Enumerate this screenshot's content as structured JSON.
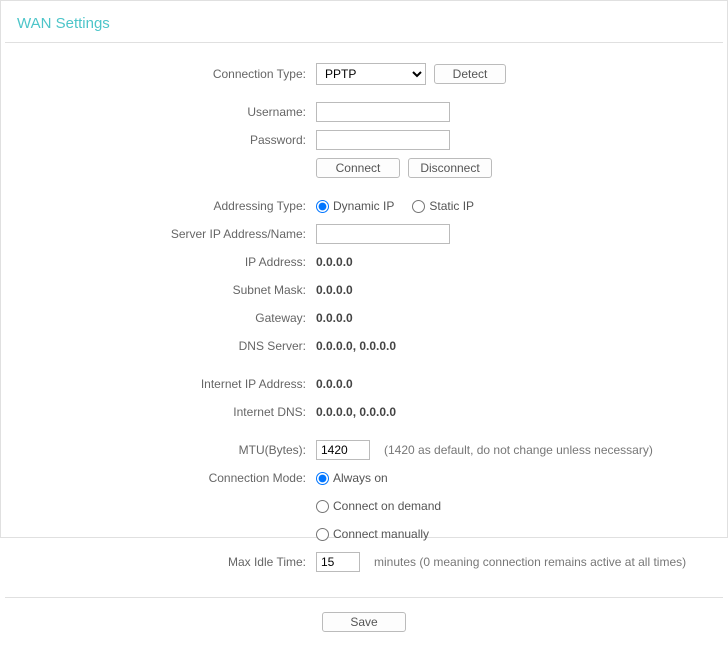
{
  "title": "WAN Settings",
  "labels": {
    "connection_type": "Connection Type:",
    "username": "Username:",
    "password": "Password:",
    "addressing_type": "Addressing Type:",
    "server_ip": "Server IP Address/Name:",
    "ip_address": "IP Address:",
    "subnet_mask": "Subnet Mask:",
    "gateway": "Gateway:",
    "dns_server": "DNS Server:",
    "internet_ip": "Internet IP Address:",
    "internet_dns": "Internet DNS:",
    "mtu": "MTU(Bytes):",
    "connection_mode": "Connection Mode:",
    "max_idle": "Max Idle Time:"
  },
  "connection_type": {
    "selected": "PPTP"
  },
  "buttons": {
    "detect": "Detect",
    "connect": "Connect",
    "disconnect": "Disconnect",
    "save": "Save"
  },
  "fields": {
    "username": "",
    "password": "",
    "server_ip_name": "",
    "mtu": "1420",
    "max_idle": "15"
  },
  "addressing": {
    "dynamic": "Dynamic IP",
    "static": "Static IP"
  },
  "status": {
    "ip_address": "0.0.0.0",
    "subnet_mask": "0.0.0.0",
    "gateway": "0.0.0.0",
    "dns_server": "0.0.0.0,   0.0.0.0",
    "internet_ip": "0.0.0.0",
    "internet_dns": "0.0.0.0,   0.0.0.0"
  },
  "mtu_hint": "(1420 as default, do not change unless necessary)",
  "conn_mode": {
    "always_on": "Always on",
    "on_demand": "Connect on demand",
    "manual": "Connect manually"
  },
  "idle_hint": "minutes (0 meaning connection remains active at all times)"
}
